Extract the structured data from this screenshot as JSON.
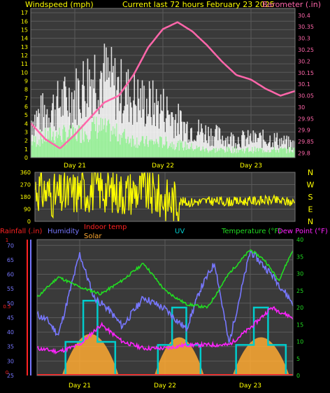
{
  "colors": {
    "wind": "#ffffff",
    "wind_light": "#90ee90",
    "barometer": "#ff66aa",
    "direction": "#ffff00",
    "humidity": "#7777ff",
    "temperature": "#22dd22",
    "dew_point": "#ff22ff",
    "uv": "#00cccc",
    "solar": "#ffaa33",
    "rainfall": "#ff2222",
    "indoor_temp": "#ff2222",
    "title": "#ffff00",
    "axis_text": "#ffff00"
  },
  "chart_data": [
    {
      "type": "line",
      "title": "Current last 72 hours February 23 2025",
      "left_axis_label": "Windspeed (mph)",
      "right_axis_label": "Barometer (.in)",
      "left_ylim": [
        0,
        17.5
      ],
      "left_ticks": [
        "0",
        "1",
        "2",
        "3",
        "4",
        "5",
        "6",
        "7",
        "8",
        "9",
        "10",
        "11",
        "12",
        "13",
        "14",
        "15",
        "16",
        "17"
      ],
      "right_ylim": [
        29.78,
        30.43
      ],
      "right_ticks": [
        "29.8",
        "29.85",
        "29.9",
        "29.95",
        "30",
        "30.05",
        "30.1",
        "30.15",
        "30.2",
        "30.25",
        "30.3",
        "30.35",
        "30.4"
      ],
      "x_labels": [
        "Day 21",
        "Day 22",
        "Day 23"
      ],
      "x_label_positions_hours": [
        12,
        36,
        60
      ],
      "x_range_hours": [
        0,
        72
      ],
      "grid": true,
      "series": [
        {
          "kind": "barometer",
          "x": [
            0,
            4,
            8,
            12,
            16,
            20,
            24,
            28,
            32,
            36,
            40,
            44,
            48,
            52,
            56,
            60,
            64,
            68,
            72
          ],
          "values": [
            29.93,
            29.86,
            29.82,
            29.88,
            29.95,
            30.02,
            30.05,
            30.14,
            30.26,
            30.34,
            30.37,
            30.33,
            30.27,
            30.2,
            30.14,
            30.12,
            30.08,
            30.05,
            30.07
          ]
        },
        {
          "kind": "windspeed_high",
          "x": [
            0,
            6,
            12,
            18,
            24,
            30,
            36,
            42,
            48,
            54,
            60,
            66,
            72
          ],
          "values": [
            6,
            8,
            10,
            14,
            11,
            9,
            8,
            5,
            4,
            3,
            3,
            3,
            2
          ]
        },
        {
          "kind": "windspeed_avg",
          "x": [
            0,
            6,
            12,
            18,
            24,
            30,
            36,
            42,
            48,
            54,
            60,
            66,
            72
          ],
          "values": [
            2,
            3,
            3,
            4,
            3,
            2,
            2,
            1.5,
            1,
            1,
            1,
            1,
            1
          ]
        }
      ]
    },
    {
      "type": "line",
      "title": "",
      "left_ticks": [
        "0",
        "90",
        "180",
        "270",
        "360"
      ],
      "left_ylim": [
        0,
        360
      ],
      "right_labels": [
        "N",
        "W",
        "S",
        "E",
        "N"
      ],
      "x_range_hours": [
        0,
        72
      ],
      "series": [
        {
          "kind": "wind_direction",
          "x": [
            0,
            6,
            12,
            18,
            24,
            30,
            36,
            42,
            48,
            54,
            60,
            66,
            72
          ],
          "values": [
            250,
            180,
            220,
            240,
            210,
            230,
            160,
            140,
            150,
            145,
            150,
            155,
            140
          ]
        }
      ]
    },
    {
      "type": "line",
      "legend": [
        "Rainfall (.in)",
        "Humidity",
        "Indoor temp",
        "Solar",
        "UV",
        "Temperature (°F)",
        "Dew Point (°F)"
      ],
      "left_ticks": [
        "25",
        "30",
        "35",
        "40",
        "45",
        "50",
        "55",
        "60",
        "65",
        "70"
      ],
      "left_ylim": [
        25,
        72
      ],
      "rain_ticks": [
        "0",
        "0.5",
        "1"
      ],
      "right_ticks": [
        "0",
        "5",
        "10",
        "15",
        "20",
        "25",
        "30",
        "35",
        "40"
      ],
      "right_ylim": [
        0,
        40
      ],
      "x_labels": [
        "Day 21",
        "Day 22",
        "Day 23"
      ],
      "x_label_positions_hours": [
        12,
        36,
        60
      ],
      "x_range_hours": [
        0,
        72
      ],
      "series": [
        {
          "name": "Temperature (°F)",
          "x": [
            0,
            6,
            12,
            18,
            24,
            30,
            36,
            42,
            48,
            54,
            60,
            64,
            68,
            72
          ],
          "values": [
            23,
            29,
            26,
            24,
            28,
            33,
            25,
            21,
            20,
            30,
            37,
            34,
            28,
            37
          ]
        },
        {
          "name": "Humidity",
          "x": [
            0,
            3,
            6,
            12,
            16,
            20,
            24,
            30,
            36,
            42,
            46,
            50,
            54,
            60,
            66,
            72
          ],
          "values": [
            46,
            44,
            39,
            67,
            52,
            48,
            42,
            52,
            48,
            41,
            55,
            64,
            36,
            68,
            60,
            50
          ]
        },
        {
          "name": "Dew Point (°F)",
          "x": [
            0,
            6,
            12,
            18,
            24,
            30,
            36,
            42,
            48,
            54,
            60,
            66,
            72
          ],
          "values": [
            8,
            7,
            9,
            15,
            10,
            8,
            8,
            9,
            9,
            9,
            14,
            20,
            17
          ]
        }
      ]
    }
  ]
}
